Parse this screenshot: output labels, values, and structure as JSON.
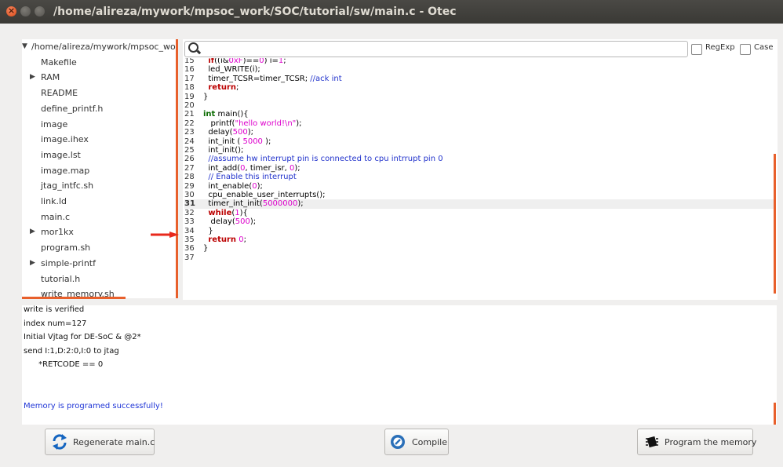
{
  "window": {
    "title": "/home/alireza/mywork/mpsoc_work/SOC/tutorial/sw/main.c - Otec"
  },
  "tree": {
    "root": "/home/alireza/mywork/mpsoc_work",
    "items": [
      {
        "label": "Makefile",
        "expandable": false
      },
      {
        "label": "RAM",
        "expandable": true
      },
      {
        "label": "README",
        "expandable": false
      },
      {
        "label": "define_printf.h",
        "expandable": false
      },
      {
        "label": "image",
        "expandable": false
      },
      {
        "label": "image.ihex",
        "expandable": false
      },
      {
        "label": "image.lst",
        "expandable": false
      },
      {
        "label": "image.map",
        "expandable": false
      },
      {
        "label": "jtag_intfc.sh",
        "expandable": false
      },
      {
        "label": "link.ld",
        "expandable": false
      },
      {
        "label": "main.c",
        "expandable": false
      },
      {
        "label": "mor1kx",
        "expandable": true
      },
      {
        "label": "program.sh",
        "expandable": false
      },
      {
        "label": "simple-printf",
        "expandable": true
      },
      {
        "label": "tutorial.h",
        "expandable": false
      },
      {
        "label": "write_memory.sh",
        "expandable": false
      }
    ]
  },
  "search": {
    "regexp_label": "RegExp",
    "case_label": "Case"
  },
  "editor": {
    "current_line": 31,
    "lines": [
      {
        "n": "15",
        "t": "  if((i&0xF)==0) i=1;"
      },
      {
        "n": "16",
        "t": "  led_WRITE(i);"
      },
      {
        "n": "17",
        "t": "  timer_TCSR=timer_TCSR; //ack int"
      },
      {
        "n": "18",
        "t": "  return;"
      },
      {
        "n": "19",
        "t": "}"
      },
      {
        "n": "20",
        "t": ""
      },
      {
        "n": "21",
        "t": "int main(){"
      },
      {
        "n": "22",
        "t": "   printf(\"hello world!\\n\");"
      },
      {
        "n": "23",
        "t": "  delay(500);"
      },
      {
        "n": "24",
        "t": "  int_init ( 5000 );"
      },
      {
        "n": "25",
        "t": "  int_init();"
      },
      {
        "n": "26",
        "t": "  //assume hw interrupt pin is connected to cpu intrrupt pin 0"
      },
      {
        "n": "27",
        "t": "  int_add(0, timer_isr, 0);"
      },
      {
        "n": "28",
        "t": "  // Enable this interrupt"
      },
      {
        "n": "29",
        "t": "  int_enable(0);"
      },
      {
        "n": "30",
        "t": "  cpu_enable_user_interrupts();"
      },
      {
        "n": "31",
        "t": "  timer_int_init(5000000);"
      },
      {
        "n": "32",
        "t": "  while(1){"
      },
      {
        "n": "33",
        "t": "   delay(500);"
      },
      {
        "n": "34",
        "t": "  }"
      },
      {
        "n": "35",
        "t": "  return 0;"
      },
      {
        "n": "36",
        "t": "}"
      },
      {
        "n": "37",
        "t": ""
      }
    ]
  },
  "console": {
    "lines": [
      "write is verified",
      "index num=127",
      "Initial Vjtag for DE-SoC & @2*",
      "send I:1,D:2:0,I:0 to jtag",
      "      *RETCODE == 0"
    ],
    "success_message": "Memory is programed successfully!",
    "success_color": "#1f35d6"
  },
  "buttons": {
    "regenerate": "Regenerate main.c",
    "compile": "Compile",
    "program": "Program the memory"
  },
  "colors": {
    "accent_orange": "#e8602c",
    "arrow_red": "#e8291c"
  }
}
